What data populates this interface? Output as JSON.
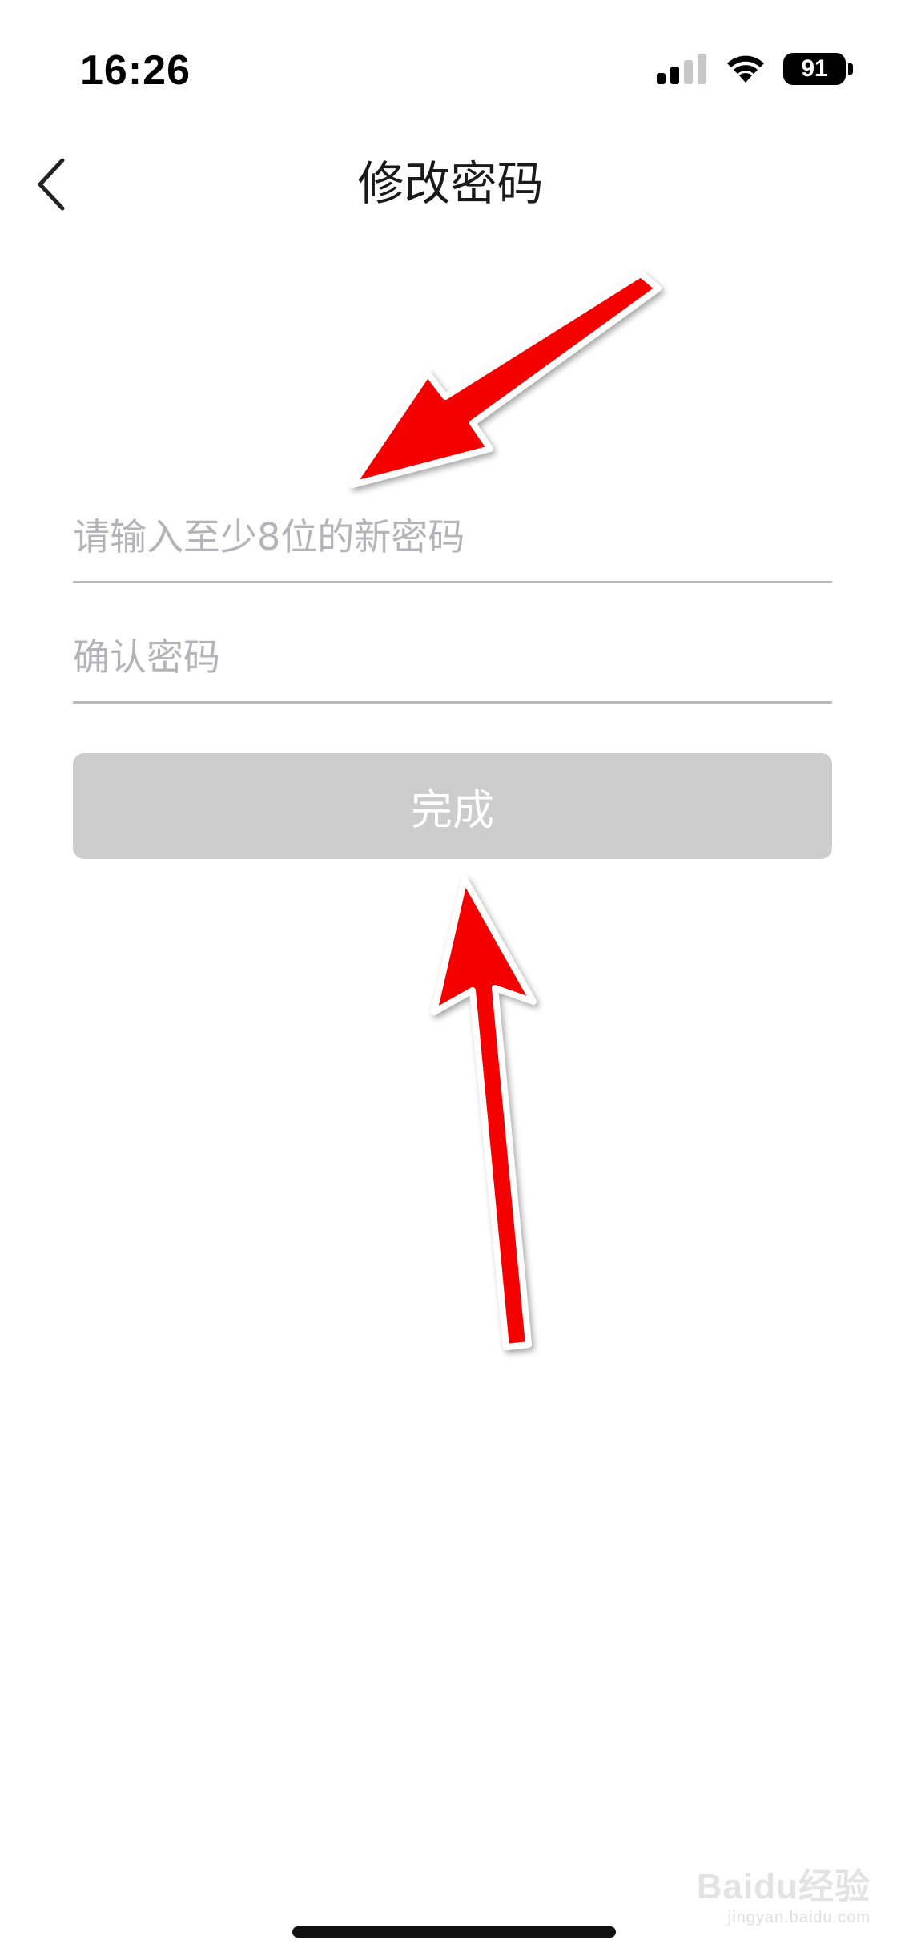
{
  "status_bar": {
    "time": "16:26",
    "battery_level": "91",
    "signal_bars_active": 2,
    "signal_bars_total": 4
  },
  "nav": {
    "title": "修改密码",
    "back_icon": "chevron-left-icon"
  },
  "form": {
    "new_password_placeholder": "请输入至少8位的新密码",
    "confirm_password_placeholder": "确认密码",
    "done_label": "完成"
  },
  "watermark": {
    "brand": "Baidu经验",
    "url": "jingyan.baidu.com"
  },
  "colors": {
    "button_disabled_bg": "#cccccc",
    "annotation_arrow": "#ff0000"
  }
}
